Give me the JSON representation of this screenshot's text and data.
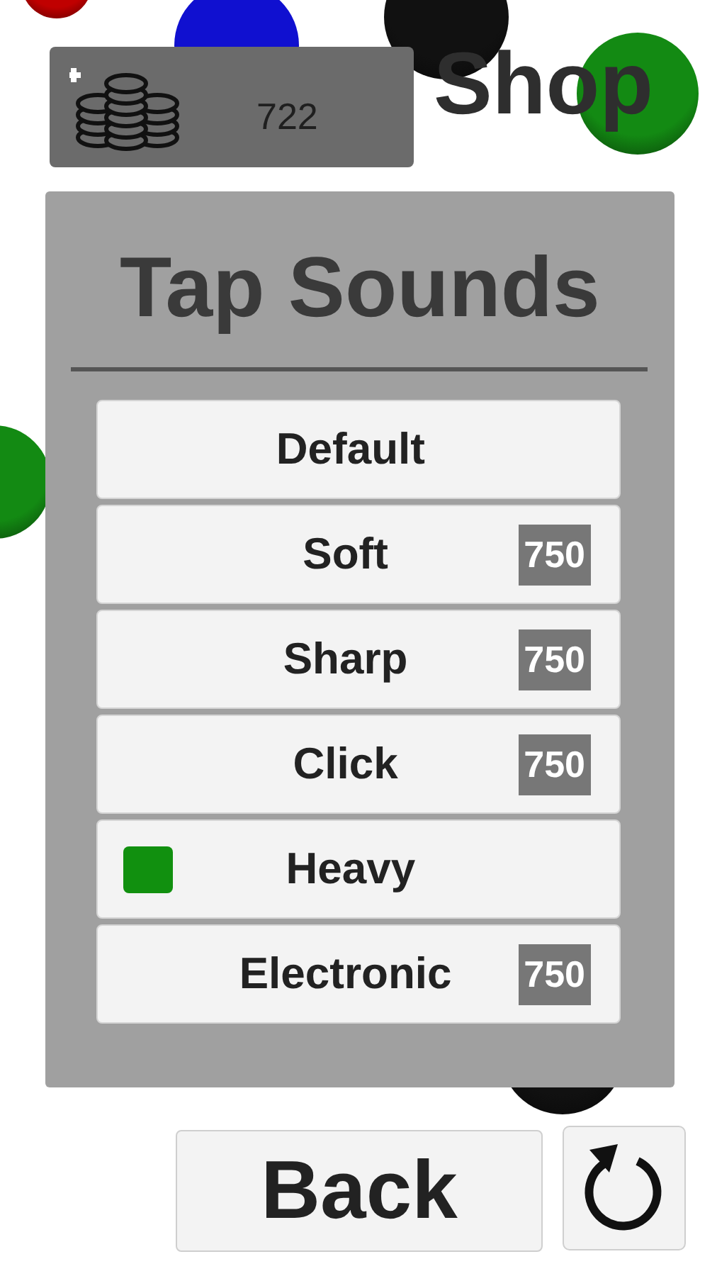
{
  "header": {
    "coins": "722",
    "title": "Shop"
  },
  "panel": {
    "title": "Tap Sounds",
    "items": [
      {
        "label": "Default",
        "selected": false
      },
      {
        "label": "Soft",
        "price": "750",
        "selected": false
      },
      {
        "label": "Sharp",
        "price": "750",
        "selected": false
      },
      {
        "label": "Click",
        "price": "750",
        "selected": false
      },
      {
        "label": "Heavy",
        "selected": true
      },
      {
        "label": "Electronic",
        "price": "750",
        "selected": false
      }
    ]
  },
  "footer": {
    "back": "Back"
  }
}
